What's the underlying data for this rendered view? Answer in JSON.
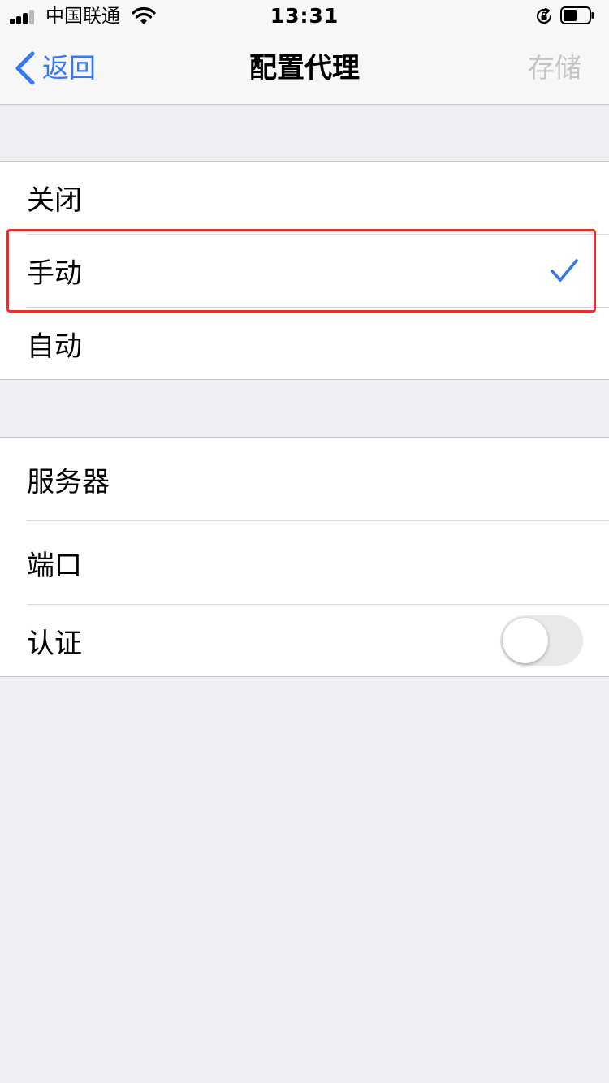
{
  "status_bar": {
    "carrier": "中国联通",
    "time": "13:31",
    "icons": [
      "signal-icon",
      "wifi-icon",
      "rotation-lock-icon",
      "battery-icon"
    ]
  },
  "nav": {
    "back_label": "返回",
    "title": "配置代理",
    "save_label": "存储"
  },
  "proxy_mode": {
    "options": [
      {
        "label": "关闭",
        "selected": false
      },
      {
        "label": "手动",
        "selected": true
      },
      {
        "label": "自动",
        "selected": false
      }
    ]
  },
  "manual_settings": {
    "server_label": "服务器",
    "port_label": "端口",
    "auth_label": "认证",
    "auth_enabled": false
  },
  "colors": {
    "accent": "#3478f6",
    "disabled": "#c4c4c8",
    "background": "#efeff4",
    "highlight": "#e5312b"
  }
}
